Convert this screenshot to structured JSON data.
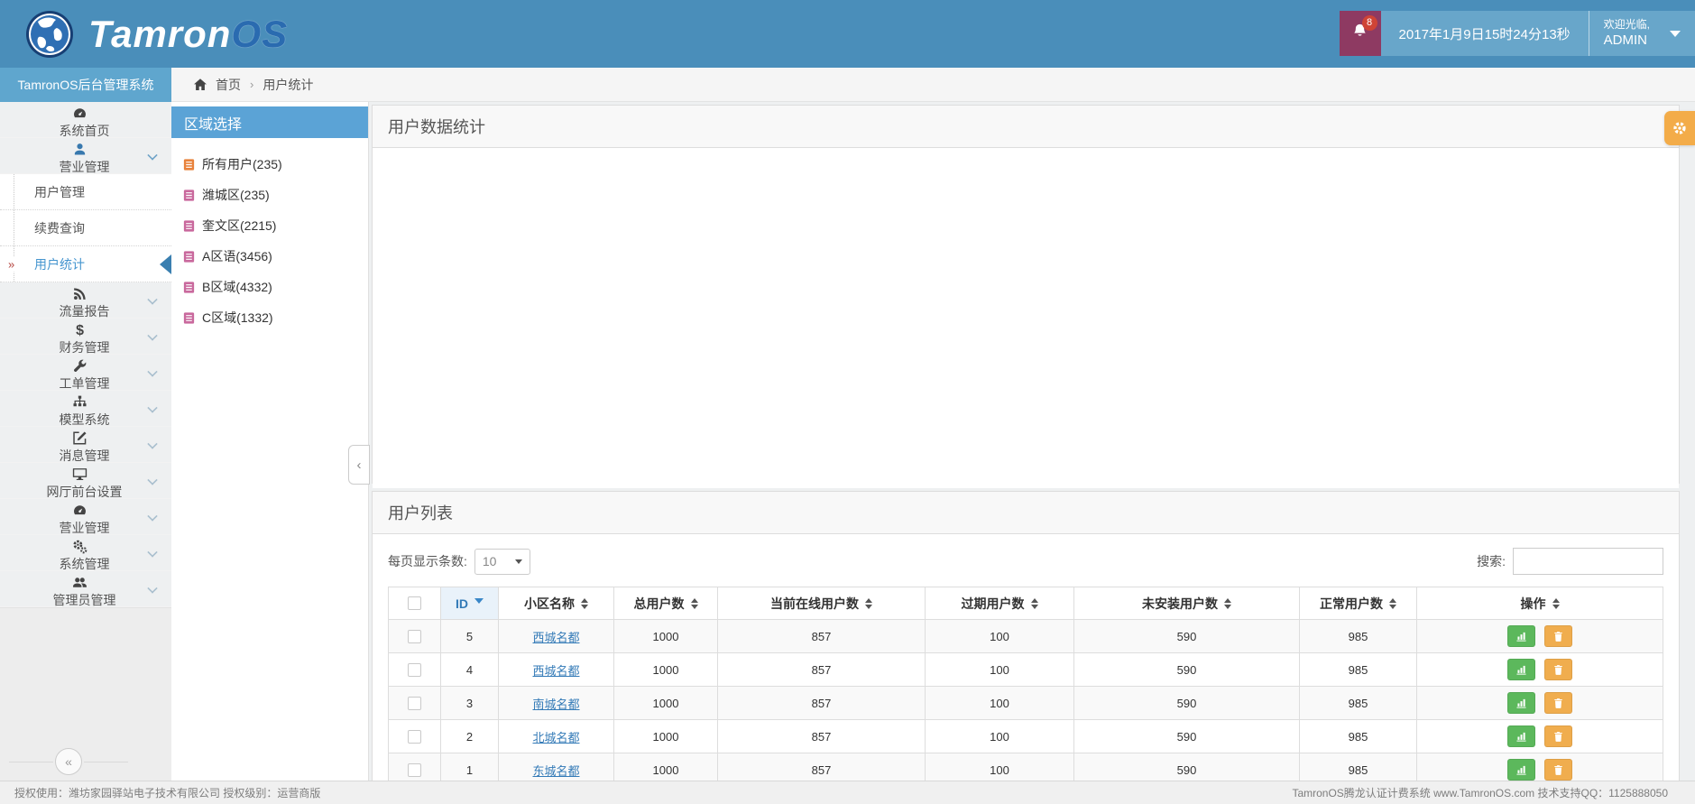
{
  "brand": {
    "logo_text_primary": "Tamron",
    "logo_text_secondary": "OS",
    "system_title": "TamronOS后台管理系统"
  },
  "header": {
    "notification_count": "8",
    "datetime": "2017年1月9日15时24分13秒",
    "welcome_line1": "欢迎光临,",
    "welcome_user": "ADMIN"
  },
  "breadcrumb": {
    "home": "首页",
    "separator": "›",
    "current": "用户统计"
  },
  "sidebar": {
    "items": [
      {
        "key": "home",
        "icon": "gauge-icon",
        "label": "系统首页",
        "type": "main",
        "expandable": false
      },
      {
        "key": "business",
        "icon": "user-icon",
        "label": "营业管理",
        "type": "main",
        "expandable": true,
        "expanded": true,
        "icon_color": "#3879ae"
      },
      {
        "key": "user-management",
        "label": "用户管理",
        "type": "sub"
      },
      {
        "key": "renewal-query",
        "label": "续费查询",
        "type": "sub"
      },
      {
        "key": "user-statistics",
        "label": "用户统计",
        "type": "sub",
        "active": true,
        "marker": "»"
      },
      {
        "key": "traffic-report",
        "icon": "rss-icon",
        "label": "流量报告",
        "type": "main",
        "expandable": true
      },
      {
        "key": "finance",
        "icon": "dollar-icon",
        "label": "财务管理",
        "type": "main",
        "expandable": true
      },
      {
        "key": "work-order",
        "icon": "wrench-icon",
        "label": "工单管理",
        "type": "main",
        "expandable": true
      },
      {
        "key": "model-system",
        "icon": "sitemap-icon",
        "label": "模型系统",
        "type": "main",
        "expandable": true
      },
      {
        "key": "message",
        "icon": "edit-icon",
        "label": "消息管理",
        "type": "main",
        "expandable": true
      },
      {
        "key": "portal-settings",
        "icon": "desktop-icon",
        "label": "网厅前台设置",
        "type": "main",
        "expandable": true
      },
      {
        "key": "business-2",
        "icon": "dashboard-icon",
        "label": "营业管理",
        "type": "main",
        "expandable": true
      },
      {
        "key": "system",
        "icon": "gears-icon",
        "label": "系统管理",
        "type": "main",
        "expandable": true
      },
      {
        "key": "admin",
        "icon": "users-icon",
        "label": "管理员管理",
        "type": "main",
        "expandable": true
      }
    ]
  },
  "region_panel": {
    "title": "区域选择",
    "items": [
      {
        "key": "all-users",
        "label": "所有用户(235)",
        "icon": "list-icon",
        "icon_color": "#e8823c"
      },
      {
        "key": "weicheng",
        "label": "潍城区(235)",
        "icon": "list-icon",
        "icon_color": "#c9699d"
      },
      {
        "key": "kuiwen",
        "label": "奎文区(2215)",
        "icon": "list-icon",
        "icon_color": "#c9699d"
      },
      {
        "key": "area-a",
        "label": "A区语(3456)",
        "icon": "list-icon",
        "icon_color": "#c9699d"
      },
      {
        "key": "area-b",
        "label": "B区域(4332)",
        "icon": "list-icon",
        "icon_color": "#c9699d"
      },
      {
        "key": "area-c",
        "label": "C区域(1332)",
        "icon": "list-icon",
        "icon_color": "#c9699d"
      }
    ]
  },
  "stats_panel": {
    "title": "用户数据统计"
  },
  "list_panel": {
    "title": "用户列表",
    "page_size_label": "每页显示条数:",
    "page_size_value": "10",
    "search_label": "搜索:"
  },
  "user_table": {
    "columns": [
      {
        "label": "",
        "type": "checkbox"
      },
      {
        "label": "ID",
        "sorted": "desc"
      },
      {
        "label": "小区名称",
        "sortable": true
      },
      {
        "label": "总用户数",
        "sortable": true
      },
      {
        "label": "当前在线用户数",
        "sortable": true
      },
      {
        "label": "过期用户数",
        "sortable": true
      },
      {
        "label": "未安装用户数",
        "sortable": true
      },
      {
        "label": "正常用户数",
        "sortable": true
      },
      {
        "label": "操作",
        "sortable": true
      }
    ],
    "rows": [
      {
        "id": "5",
        "name": "西城名都",
        "total": "1000",
        "online": "857",
        "expired": "100",
        "uninstalled": "590",
        "normal": "985"
      },
      {
        "id": "4",
        "name": "西城名都",
        "total": "1000",
        "online": "857",
        "expired": "100",
        "uninstalled": "590",
        "normal": "985"
      },
      {
        "id": "3",
        "name": "南城名都",
        "total": "1000",
        "online": "857",
        "expired": "100",
        "uninstalled": "590",
        "normal": "985"
      },
      {
        "id": "2",
        "name": "北城名都",
        "total": "1000",
        "online": "857",
        "expired": "100",
        "uninstalled": "590",
        "normal": "985"
      },
      {
        "id": "1",
        "name": "东城名都",
        "total": "1000",
        "online": "857",
        "expired": "100",
        "uninstalled": "590",
        "normal": "985"
      }
    ],
    "actions": [
      {
        "key": "view-chart-button",
        "icon": "chart-icon",
        "color": "#5cb85c"
      },
      {
        "key": "delete-button",
        "icon": "trash-icon",
        "color": "#f0ad4e"
      }
    ]
  },
  "footer": {
    "left": "授权使用：潍坊家园驿站电子技术有限公司  授权级别：运营商版",
    "right": "TamronOS腾龙认证计费系统 www.TamronOS.com 技术支持QQ：1125888050"
  },
  "colors": {
    "header_bg": "#4a8eba",
    "sidebar_title_bg": "#5fa6ce",
    "region_title_bg": "#5ba3d6",
    "bell_bg": "#8e3a62",
    "badge_bg": "#cf4436",
    "active_link": "#4595cf",
    "table_link": "#337ab7",
    "button_green": "#5cb85c",
    "button_orange": "#f0ad4e",
    "settings_tab": "#f3ac49"
  }
}
